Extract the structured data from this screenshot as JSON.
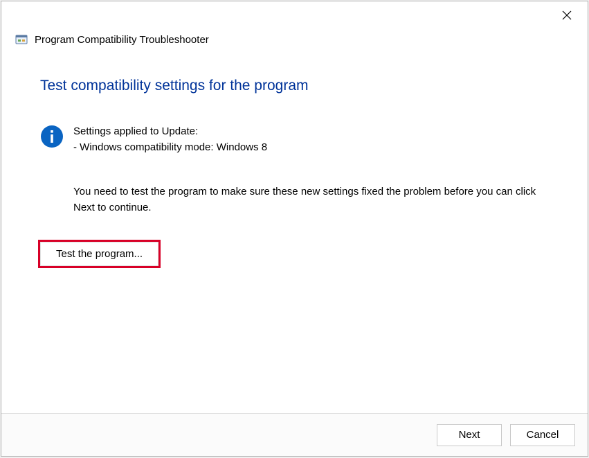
{
  "titlebar": {
    "close_label": "Close"
  },
  "header": {
    "wizard_title": "Program Compatibility Troubleshooter"
  },
  "page": {
    "heading": "Test compatibility settings for the program",
    "info_line1": "Settings applied to Update:",
    "info_line2": "- Windows compatibility mode: Windows 8",
    "instruction": "You need to test the program to make sure these new settings fixed the problem before you can click Next to continue.",
    "test_button": "Test the program..."
  },
  "footer": {
    "next_label": "Next",
    "cancel_label": "Cancel"
  }
}
